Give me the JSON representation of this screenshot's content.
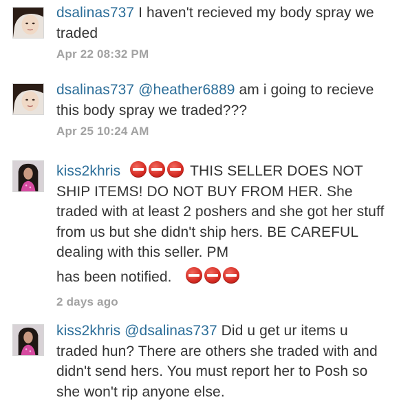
{
  "comments": [
    {
      "username": "dsalinas737",
      "text": "I haven't recieved my body spray we traded",
      "time": "Apr 22 08:32 PM"
    },
    {
      "username": "dsalinas737",
      "mention": "@heather6889",
      "text": "am i going to recieve this body spray we traded???",
      "time": "Apr 25 10:24 AM"
    },
    {
      "username": "kiss2khris",
      "icon": "no-entry-icon",
      "text": "THIS SELLER DOES NOT SHIP ITEMS! DO NOT BUY FROM HER. She traded with at least 2 poshers and she got her stuff from us but she didn't ship hers. BE CAREFUL dealing with this seller.  PM",
      "text_tail": "has been notified.",
      "time": "2 days ago"
    },
    {
      "username": "kiss2khris",
      "mention": "@dsalinas737",
      "text": "Did u get ur items u traded hun?  There are others she traded with and didn't send hers. You must report her to Posh so she won't rip anyone else."
    }
  ],
  "colors": {
    "username": "#2c6e99",
    "timestamp": "#a2a2a2",
    "no_entry": "#d42a22"
  }
}
